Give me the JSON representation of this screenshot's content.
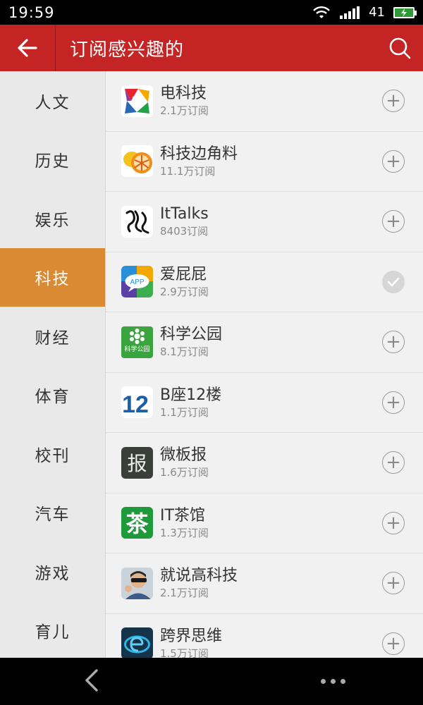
{
  "status_bar": {
    "time": "19:59",
    "battery": "41"
  },
  "header": {
    "title": "订阅感兴趣的"
  },
  "categories": [
    {
      "label": "人文"
    },
    {
      "label": "历史"
    },
    {
      "label": "娱乐"
    },
    {
      "label": "科技"
    },
    {
      "label": "财经"
    },
    {
      "label": "体育"
    },
    {
      "label": "校刊"
    },
    {
      "label": "汽车"
    },
    {
      "label": "游戏"
    },
    {
      "label": "育儿"
    }
  ],
  "active_category": "科技",
  "items": [
    {
      "name": "电科技",
      "subs": "2.1万订阅",
      "subscribed": false
    },
    {
      "name": "科技边角料",
      "subs": "11.1万订阅",
      "subscribed": false
    },
    {
      "name": "ItTalks",
      "subs": "8403订阅",
      "subscribed": false
    },
    {
      "name": "爱屁屁",
      "subs": "2.9万订阅",
      "subscribed": true,
      "logo_text": "APP"
    },
    {
      "name": "科学公园",
      "subs": "8.1万订阅",
      "subscribed": false,
      "logo_text": "科学公园"
    },
    {
      "name": "B座12楼",
      "subs": "1.1万订阅",
      "subscribed": false,
      "logo_text": "12"
    },
    {
      "name": "微板报",
      "subs": "1.6万订阅",
      "subscribed": false,
      "logo_text": "报"
    },
    {
      "name": "IT茶馆",
      "subs": "1.3万订阅",
      "subscribed": false,
      "logo_text": "茶"
    },
    {
      "name": "就说高科技",
      "subs": "2.1万订阅",
      "subscribed": false
    },
    {
      "name": "跨界思维",
      "subs": "1.5万订阅",
      "subscribed": false
    }
  ],
  "colors": {
    "header": "#c42424",
    "active_category": "#d98a33",
    "sidebar": "#e9e9e9"
  }
}
